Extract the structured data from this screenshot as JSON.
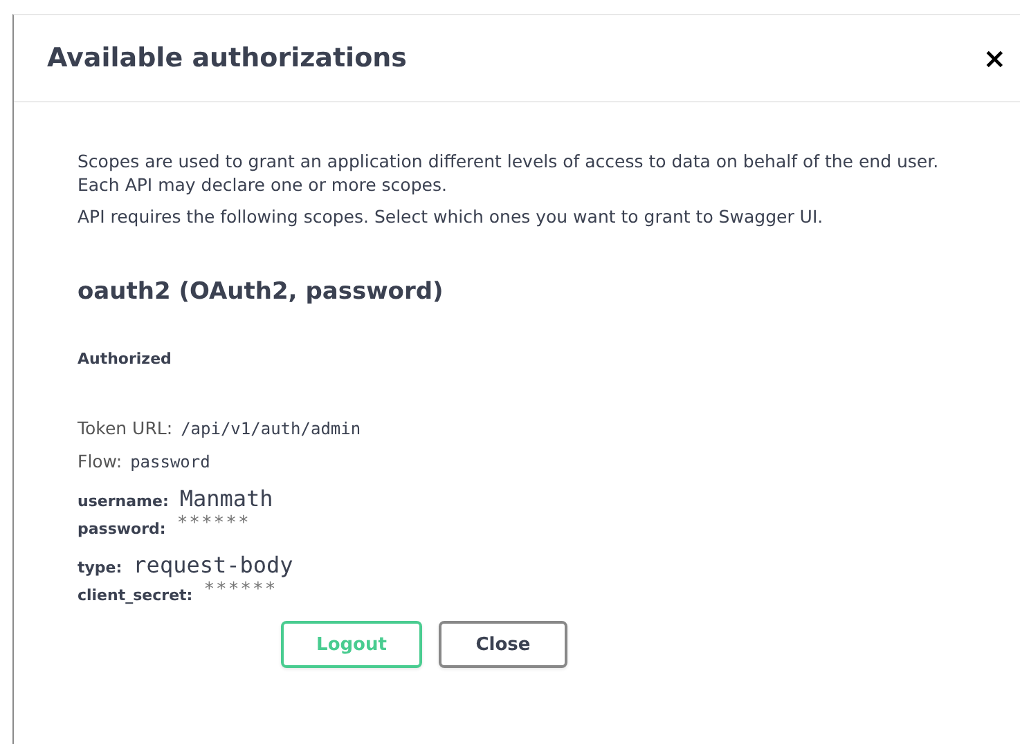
{
  "dialog": {
    "title": "Available authorizations",
    "close_icon": "×"
  },
  "description": [
    "Scopes are used to grant an application different levels of access to data on behalf of the end user. Each API may declare one or more scopes.",
    "API requires the following scopes. Select which ones you want to grant to Swagger UI."
  ],
  "scheme": {
    "heading": "oauth2 (OAuth2, password)",
    "status": "Authorized",
    "token_url": {
      "label": "Token URL:",
      "value": "/api/v1/auth/admin"
    },
    "flow": {
      "label": "Flow:",
      "value": "password"
    },
    "fields": [
      {
        "label": "username:",
        "value": "Manmath",
        "kind": "text"
      },
      {
        "label": "password:",
        "value": "******",
        "kind": "masked"
      },
      {
        "label": "type:",
        "value": "request-body",
        "kind": "text"
      },
      {
        "label": "client_secret:",
        "value": "******",
        "kind": "masked"
      }
    ]
  },
  "buttons": [
    {
      "label": "Logout",
      "kind": "primary"
    },
    {
      "label": "Close",
      "kind": "secondary"
    }
  ]
}
